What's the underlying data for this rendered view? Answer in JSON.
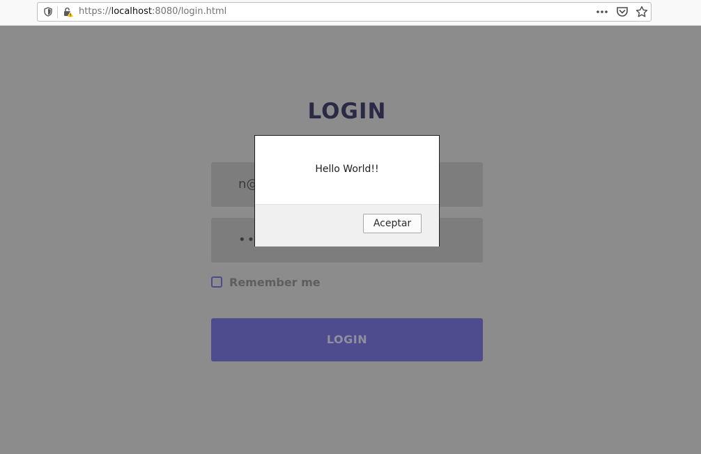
{
  "browser": {
    "url_scheme": "https://",
    "url_host": "localhost",
    "url_rest": ":8080/login.html",
    "icons": [
      "shield-icon",
      "insecure-lock-icon",
      "more-actions-icon",
      "pocket-icon",
      "bookmark-star-icon"
    ]
  },
  "page": {
    "title": "LOGIN",
    "email_value": "n@",
    "password_value": "••",
    "remember_label": "Remember me",
    "remember_checked": false,
    "login_button": "LOGIN",
    "colors": {
      "overlay_bg": "#8c8c8c",
      "title": "#2b2a46",
      "button_bg": "#4f4b8f"
    }
  },
  "dialog": {
    "message": "Hello World!!",
    "ok_label": "Aceptar"
  }
}
